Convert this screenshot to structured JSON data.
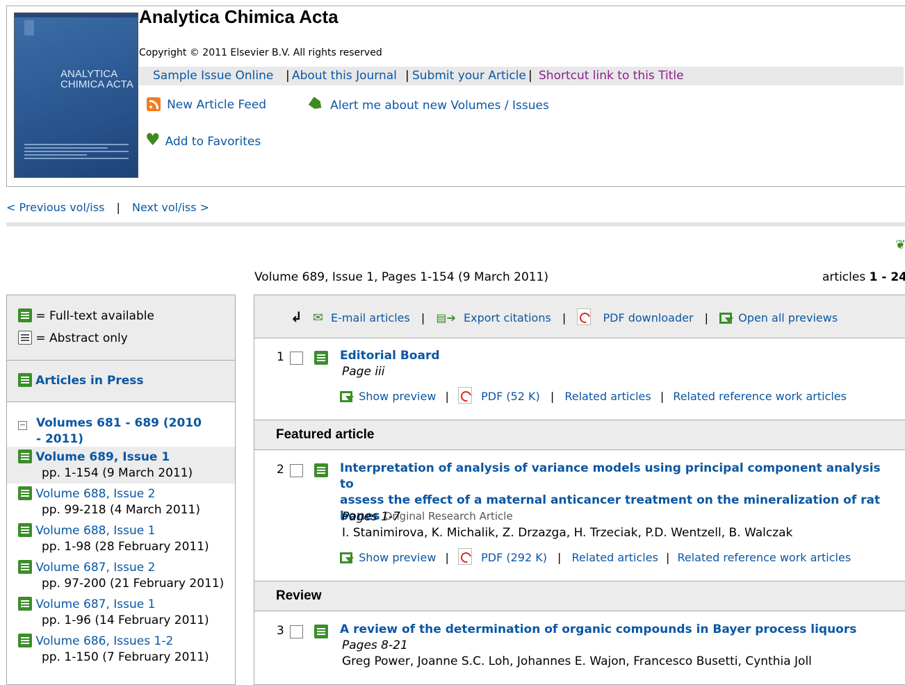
{
  "journal": {
    "title": "Analytica Chimica Acta",
    "copyright": "Copyright © 2011 Elsevier B.V. All rights reserved",
    "cover_title_line1": "ANALYTICA",
    "cover_title_line2": "CHIMICA ACTA",
    "links": [
      "Sample Issue Online",
      "About this Journal",
      "Submit your Article",
      "Shortcut link to this Title"
    ],
    "feed_label": "New Article Feed",
    "alert_label": "Alert me about new Volumes / Issues",
    "favorites_label": "Add to Favorites"
  },
  "nav": {
    "previous": "< Previous vol/iss",
    "separator": "|",
    "next": "Next vol/iss >"
  },
  "issue": {
    "info": "Volume 689, Issue 1, Pages 1-154 (9 March 2011)",
    "count_prefix": "articles ",
    "count_range": "1 - 24"
  },
  "sidebar": {
    "legend_full": "= Full-text available",
    "legend_abstract": "= Abstract only",
    "articles_in_press": "Articles in Press",
    "volume_group": "Volumes 681 - 689 (2010 - 2011)",
    "volumes": [
      {
        "label": "Volume 689, Issue 1",
        "pages": "pp. 1-154 (9 March 2011)"
      },
      {
        "label": "Volume 688, Issue 2",
        "pages": "pp. 99-218 (4 March 2011)"
      },
      {
        "label": "Volume 688, Issue 1",
        "pages": "pp. 1-98 (28 February 2011)"
      },
      {
        "label": "Volume 687, Issue 2",
        "pages": "pp. 97-200 (21 February 2011)"
      },
      {
        "label": "Volume 687, Issue 1",
        "pages": "pp. 1-96 (14 February 2011)"
      },
      {
        "label": "Volume 686, Issues 1-2",
        "pages": "pp. 1-150 (7 February 2011)"
      }
    ]
  },
  "toolbar": {
    "email": "E-mail articles",
    "export": "Export citations",
    "pdf_downloader": "PDF downloader",
    "open_previews": "Open all previews",
    "sep": "|"
  },
  "articles": [
    {
      "num": "1",
      "title": "Editorial Board",
      "pages": "Page iii",
      "show_preview": "Show preview",
      "pdf": "PDF (52 K)",
      "related": "Related articles",
      "related_ref": "Related reference work articles"
    },
    {
      "num": "2",
      "title_l1": "Interpretation of analysis of variance models using principal component analysis to",
      "title_l2": "assess the effect of a maternal anticancer treatment on the mineralization of rat",
      "title_l3": "bones",
      "type": "Original Research Article",
      "pages": "Pages 1-7",
      "authors": "I. Stanimirova, K. Michalik, Z. Drzazga, H. Trzeciak, P.D. Wentzell, B. Walczak",
      "show_preview": "Show preview",
      "pdf": "PDF (292 K)",
      "related": "Related articles",
      "related_ref": "Related reference work articles"
    },
    {
      "num": "3",
      "title": "A review of the determination of organic compounds in Bayer process liquors",
      "pages": "Pages 8-21",
      "authors": "Greg Power, Joanne S.C. Loh, Johannes E. Wajon, Francesco Busetti, Cynthia Joll"
    }
  ],
  "sections": {
    "featured": "Featured article",
    "review": "Review"
  }
}
